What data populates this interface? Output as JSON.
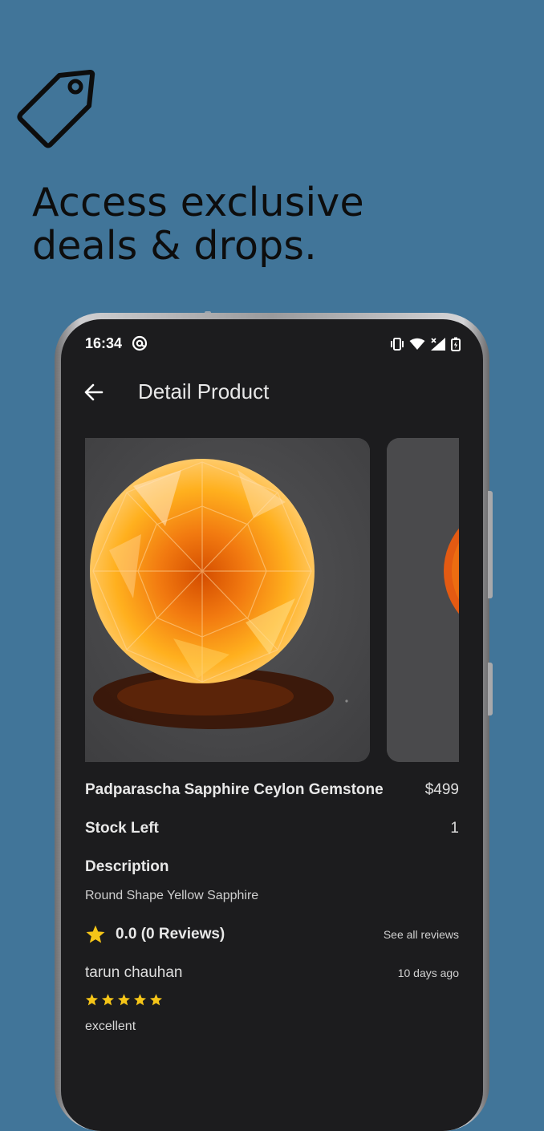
{
  "headline": {
    "line1": "Access exclusive",
    "line2": "deals & drops."
  },
  "status_bar": {
    "time": "16:34"
  },
  "app_bar": {
    "title": "Detail Product"
  },
  "product": {
    "name": "Padparascha Sapphire Ceylon Gemstone",
    "price": "$499",
    "stock_label": "Stock Left",
    "stock_value": "1",
    "description_label": "Description",
    "description": "Round Shape Yellow Sapphire"
  },
  "reviews": {
    "summary": "0.0 (0 Reviews)",
    "see_all": "See all reviews",
    "items": [
      {
        "author": "tarun chauhan",
        "date": "10 days ago",
        "rating": 5,
        "text": "excellent"
      }
    ]
  },
  "colors": {
    "background": "#417599",
    "screen": "#1c1c1e",
    "star": "#f5c518"
  },
  "icons": [
    "price-tag-icon",
    "back-arrow-icon",
    "star-icon",
    "vibrate-icon",
    "wifi-icon",
    "signal-icon",
    "battery-icon",
    "at-sign-icon"
  ]
}
